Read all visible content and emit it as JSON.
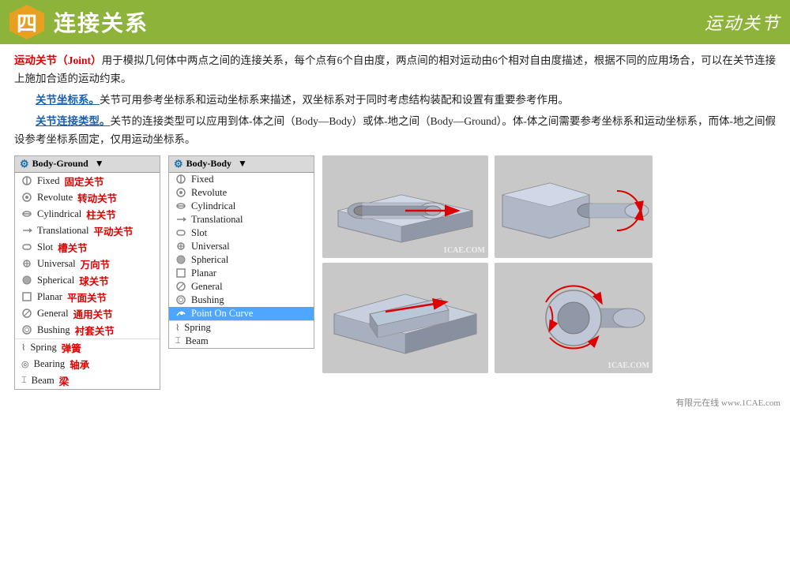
{
  "header": {
    "num": "四",
    "title": "连接关系",
    "subtitle": "运动关节"
  },
  "paragraphs": {
    "p1_prefix": "运动关节（Joint）",
    "p1_main": "用于模拟几何体中两点之间的连接关系，每个点有6个自由度，两点间的相对运动由6个相对自由度描述，根据不同的应用场合，可以在关节连接上施加合适的运动约束。",
    "p2_prefix": "关节坐标系。",
    "p2_main": "关节可用参考坐标系和运动坐标系来描述，双坐标系对于同时考虑结构装配和设置有重要参考作用。",
    "p3_prefix": "关节连接类型。",
    "p3_main": "关节的连接类型可以应用到体-体之间（Body—Body）或体-地之间（Body—Ground）。体-体之间需要参考坐标系和运动坐标系，而体-地之间假设参考坐标系固定，仅用运动坐标系。"
  },
  "panel_bg": {
    "title": "Body-Ground",
    "items": [
      {
        "label": "Fixed",
        "label_cn": "固定关节"
      },
      {
        "label": "Revolute",
        "label_cn": "转动关节"
      },
      {
        "label": "Cylindrical",
        "label_cn": "柱关节"
      },
      {
        "label": "Translational",
        "label_cn": "平动关节"
      },
      {
        "label": "Slot",
        "label_cn": "槽关节"
      },
      {
        "label": "Universal",
        "label_cn": "万向节"
      },
      {
        "label": "Spherical",
        "label_cn": "球关节"
      },
      {
        "label": "Planar",
        "label_cn": "平面关节"
      },
      {
        "label": "General",
        "label_cn": "通用关节"
      },
      {
        "label": "Bushing",
        "label_cn": "衬套关节"
      }
    ],
    "spring": {
      "label": "Spring",
      "label_cn": "弹簧"
    },
    "bearing": {
      "label": "Bearing",
      "label_cn": "轴承"
    },
    "beam": {
      "label": "Beam",
      "label_cn": "梁"
    }
  },
  "panel_bb": {
    "title": "Body-Body",
    "items": [
      {
        "label": "Fixed",
        "label_cn": "",
        "highlighted": false
      },
      {
        "label": "Revolute",
        "label_cn": "",
        "highlighted": false
      },
      {
        "label": "Cylindrical",
        "label_cn": "",
        "highlighted": false
      },
      {
        "label": "Translational",
        "label_cn": "",
        "highlighted": false
      },
      {
        "label": "Slot",
        "label_cn": "",
        "highlighted": false
      },
      {
        "label": "Universal",
        "label_cn": "",
        "highlighted": false
      },
      {
        "label": "Spherical",
        "label_cn": "",
        "highlighted": false
      },
      {
        "label": "Planar",
        "label_cn": "",
        "highlighted": false
      },
      {
        "label": "General",
        "label_cn": "",
        "highlighted": false
      },
      {
        "label": "Bushing",
        "label_cn": "",
        "highlighted": false
      },
      {
        "label": "Point On Curve",
        "label_cn": "",
        "highlighted": true
      }
    ],
    "spring": {
      "label": "Spring",
      "label_cn": ""
    },
    "beam": {
      "label": "Beam",
      "label_cn": ""
    }
  },
  "watermark": {
    "text": "1CAE.COM"
  },
  "footer": {
    "brand1": "有限",
    "brand2": "元在线",
    "url": "www.1CAE.com"
  },
  "colors": {
    "header_bg": "#8db33a",
    "num_bg": "#e8a020",
    "red": "#cc0000",
    "blue": "#1a5fad",
    "highlight": "#4da6ff"
  }
}
